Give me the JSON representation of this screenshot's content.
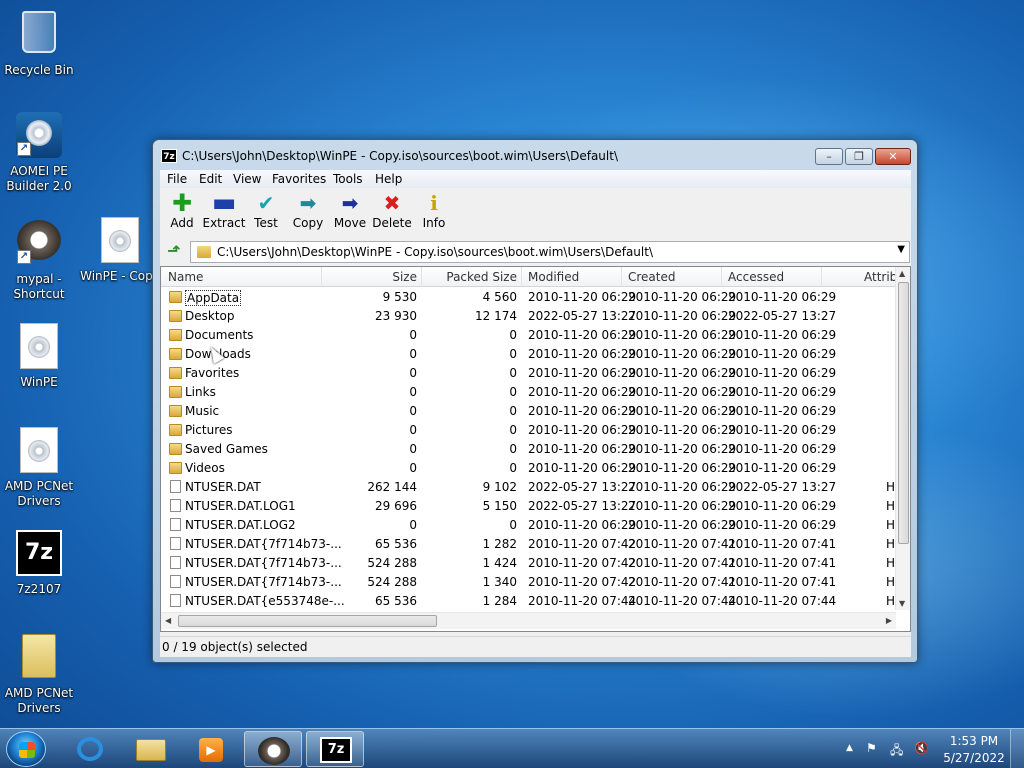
{
  "desktop": {
    "icons": [
      {
        "label": "Recycle Bin"
      },
      {
        "label": "AOMEI PE Builder 2.0"
      },
      {
        "label": "mypal - Shortcut"
      },
      {
        "label": "WinPE - Copy"
      },
      {
        "label": "WinPE"
      },
      {
        "label": "AMD PCNet Drivers"
      },
      {
        "label": "7z2107"
      },
      {
        "label": "AMD PCNet Drivers"
      }
    ]
  },
  "window": {
    "title": "C:\\Users\\John\\Desktop\\WinPE - Copy.iso\\sources\\boot.wim\\Users\\Default\\",
    "app_icon_text": "7z",
    "menu": [
      "File",
      "Edit",
      "View",
      "Favorites",
      "Tools",
      "Help"
    ],
    "toolbar": [
      {
        "label": "Add",
        "icon": "add-icon"
      },
      {
        "label": "Extract",
        "icon": "extract-icon"
      },
      {
        "label": "Test",
        "icon": "test-icon"
      },
      {
        "label": "Copy",
        "icon": "copy-icon"
      },
      {
        "label": "Move",
        "icon": "move-icon"
      },
      {
        "label": "Delete",
        "icon": "delete-icon"
      },
      {
        "label": "Info",
        "icon": "info-icon"
      }
    ],
    "address": "C:\\Users\\John\\Desktop\\WinPE - Copy.iso\\sources\\boot.wim\\Users\\Default\\",
    "columns": [
      "Name",
      "Size",
      "Packed Size",
      "Modified",
      "Created",
      "Accessed",
      "Attrib"
    ],
    "rows": [
      {
        "type": "folder",
        "name": "AppData",
        "size": "9 530",
        "packed": "4 560",
        "modified": "2010-11-20 06:29",
        "created": "2010-11-20 06:29",
        "accessed": "2010-11-20 06:29",
        "attrib": ""
      },
      {
        "type": "folder",
        "name": "Desktop",
        "size": "23 930",
        "packed": "12 174",
        "modified": "2022-05-27 13:27",
        "created": "2010-11-20 06:29",
        "accessed": "2022-05-27 13:27",
        "attrib": ""
      },
      {
        "type": "folder",
        "name": "Documents",
        "size": "0",
        "packed": "0",
        "modified": "2010-11-20 06:29",
        "created": "2010-11-20 06:29",
        "accessed": "2010-11-20 06:29",
        "attrib": ""
      },
      {
        "type": "folder",
        "name": "Downloads",
        "size": "0",
        "packed": "0",
        "modified": "2010-11-20 06:29",
        "created": "2010-11-20 06:29",
        "accessed": "2010-11-20 06:29",
        "attrib": ""
      },
      {
        "type": "folder",
        "name": "Favorites",
        "size": "0",
        "packed": "0",
        "modified": "2010-11-20 06:29",
        "created": "2010-11-20 06:29",
        "accessed": "2010-11-20 06:29",
        "attrib": ""
      },
      {
        "type": "folder",
        "name": "Links",
        "size": "0",
        "packed": "0",
        "modified": "2010-11-20 06:29",
        "created": "2010-11-20 06:29",
        "accessed": "2010-11-20 06:29",
        "attrib": ""
      },
      {
        "type": "folder",
        "name": "Music",
        "size": "0",
        "packed": "0",
        "modified": "2010-11-20 06:29",
        "created": "2010-11-20 06:29",
        "accessed": "2010-11-20 06:29",
        "attrib": ""
      },
      {
        "type": "folder",
        "name": "Pictures",
        "size": "0",
        "packed": "0",
        "modified": "2010-11-20 06:29",
        "created": "2010-11-20 06:29",
        "accessed": "2010-11-20 06:29",
        "attrib": ""
      },
      {
        "type": "folder",
        "name": "Saved Games",
        "size": "0",
        "packed": "0",
        "modified": "2010-11-20 06:29",
        "created": "2010-11-20 06:29",
        "accessed": "2010-11-20 06:29",
        "attrib": ""
      },
      {
        "type": "folder",
        "name": "Videos",
        "size": "0",
        "packed": "0",
        "modified": "2010-11-20 06:29",
        "created": "2010-11-20 06:29",
        "accessed": "2010-11-20 06:29",
        "attrib": ""
      },
      {
        "type": "file",
        "name": "NTUSER.DAT",
        "size": "262 144",
        "packed": "9 102",
        "modified": "2022-05-27 13:27",
        "created": "2010-11-20 06:29",
        "accessed": "2022-05-27 13:27",
        "attrib": "H"
      },
      {
        "type": "file",
        "name": "NTUSER.DAT.LOG1",
        "size": "29 696",
        "packed": "5 150",
        "modified": "2022-05-27 13:27",
        "created": "2010-11-20 06:29",
        "accessed": "2010-11-20 06:29",
        "attrib": "H"
      },
      {
        "type": "file",
        "name": "NTUSER.DAT.LOG2",
        "size": "0",
        "packed": "0",
        "modified": "2010-11-20 06:29",
        "created": "2010-11-20 06:29",
        "accessed": "2010-11-20 06:29",
        "attrib": "H"
      },
      {
        "type": "file",
        "name": "NTUSER.DAT{7f714b73-...",
        "size": "65 536",
        "packed": "1 282",
        "modified": "2010-11-20 07:42",
        "created": "2010-11-20 07:41",
        "accessed": "2010-11-20 07:41",
        "attrib": "H"
      },
      {
        "type": "file",
        "name": "NTUSER.DAT{7f714b73-...",
        "size": "524 288",
        "packed": "1 424",
        "modified": "2010-11-20 07:42",
        "created": "2010-11-20 07:41",
        "accessed": "2010-11-20 07:41",
        "attrib": "H"
      },
      {
        "type": "file",
        "name": "NTUSER.DAT{7f714b73-...",
        "size": "524 288",
        "packed": "1 340",
        "modified": "2010-11-20 07:42",
        "created": "2010-11-20 07:41",
        "accessed": "2010-11-20 07:41",
        "attrib": "H"
      },
      {
        "type": "file",
        "name": "NTUSER.DAT{e553748e-...",
        "size": "65 536",
        "packed": "1 284",
        "modified": "2010-11-20 07:44",
        "created": "2010-11-20 07:44",
        "accessed": "2010-11-20 07:44",
        "attrib": "H"
      }
    ],
    "status": "0 / 19 object(s) selected"
  },
  "taskbar": {
    "time": "1:53 PM",
    "date": "5/27/2022"
  },
  "colors": {
    "toolbar_add": "#1a9e1a",
    "toolbar_extract": "#1c3fa8",
    "toolbar_test": "#17a3b3",
    "toolbar_copy": "#1d8a9a",
    "toolbar_move": "#1e2f9e",
    "toolbar_delete": "#d81e1e",
    "toolbar_info": "#c9a400"
  }
}
